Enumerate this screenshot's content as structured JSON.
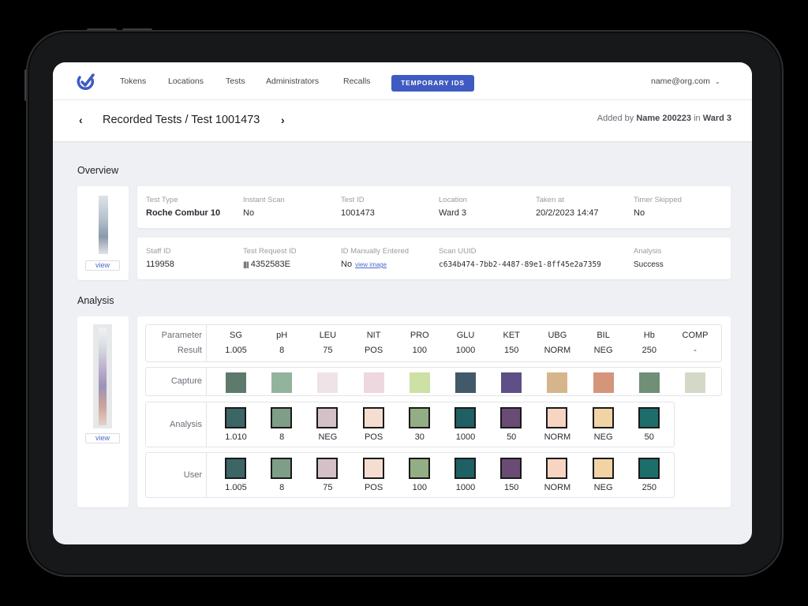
{
  "nav": {
    "items": [
      "Tokens",
      "Locations",
      "Tests",
      "Administrators",
      "Recalls"
    ],
    "button_label": "TEMPORARY IDS",
    "user_email": "name@org.com"
  },
  "breadcrumb": {
    "title": "Recorded Tests / Test 1001473",
    "added_prefix": "Added by",
    "added_name": "Name 200223",
    "added_in": "in",
    "added_ward": "Ward 3"
  },
  "overview": {
    "title": "Overview",
    "view_label": "view",
    "row1": [
      {
        "label": "Test Type",
        "value": "Roche Combur 10"
      },
      {
        "label": "Instant Scan",
        "value": "No"
      },
      {
        "label": "Test ID",
        "value": "1001473"
      },
      {
        "label": "Location",
        "value": "Ward 3"
      },
      {
        "label": "Taken at",
        "value": "20/2/2023 14:47"
      },
      {
        "label": "Timer Skipped",
        "value": "No"
      }
    ],
    "row2": [
      {
        "label": "Staff ID",
        "value": "119958"
      },
      {
        "label": "Test Request ID",
        "value": "4352583E"
      },
      {
        "label": "ID Manually Entered",
        "value": "No",
        "link": "view image"
      },
      {
        "label": "Scan UUID",
        "value": "c634b474-7bb2-4487-89e1-8ff45e2a7359"
      },
      {
        "label": "Analysis",
        "value": "Success"
      }
    ]
  },
  "analysis": {
    "title": "Analysis",
    "view_label": "view",
    "row_labels": {
      "parameter": "Parameter",
      "result": "Result",
      "capture": "Capture",
      "analysis": "Analysis",
      "user": "User"
    },
    "parameters": [
      "SG",
      "pH",
      "LEU",
      "NIT",
      "PRO",
      "GLU",
      "KET",
      "UBG",
      "BIL",
      "Hb",
      "COMP"
    ],
    "results": [
      "1.005",
      "8",
      "75",
      "POS",
      "100",
      "1000",
      "150",
      "NORM",
      "NEG",
      "250",
      "-"
    ],
    "capture_colors": [
      "#5e7a6d",
      "#93b49c",
      "#efe3e8",
      "#efd7df",
      "#cde0a6",
      "#42596a",
      "#5e4f86",
      "#d6b58d",
      "#d4957a",
      "#6f8f76",
      "#d4d8c6"
    ],
    "analysis_values": [
      "1.010",
      "8",
      "NEG",
      "POS",
      "30",
      "1000",
      "50",
      "NORM",
      "NEG",
      "50"
    ],
    "analysis_colors": [
      "#3c6566",
      "#7f9e88",
      "#d4c1c8",
      "#f5ddd0",
      "#93ae85",
      "#1e6064",
      "#6a4b75",
      "#f8d4c3",
      "#f2d4a4",
      "#1d6e6a"
    ],
    "user_values": [
      "1.005",
      "8",
      "75",
      "POS",
      "100",
      "1000",
      "150",
      "NORM",
      "NEG",
      "250"
    ],
    "user_colors": [
      "#3c6566",
      "#7f9e88",
      "#d4c1c8",
      "#f5ddd0",
      "#93ae85",
      "#1e6064",
      "#6a4b75",
      "#f8d4c3",
      "#f2d4a4",
      "#1d6e6a"
    ]
  }
}
